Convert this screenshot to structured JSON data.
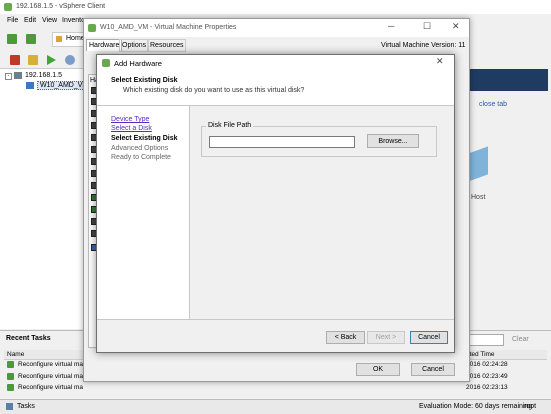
{
  "vsphere": {
    "title": "192.168.1.5 - vSphere Client",
    "menu": [
      "File",
      "Edit",
      "View",
      "Invento"
    ],
    "home_label": "Home",
    "tree": {
      "host": "192.168.1.5",
      "vm": "W10_AMD_VM"
    },
    "close_tab": "close tab",
    "host_label": "Host",
    "clear_label": "Clear",
    "recent_tasks_title": "Recent Tasks",
    "name_header": "Name",
    "completed_time_header": "eted Time",
    "tasks": [
      {
        "name": "Reconfigure virtual ma",
        "time": "2016 02:24:28"
      },
      {
        "name": "Reconfigure virtual ma",
        "time": "2016 02:23:49"
      },
      {
        "name": "Reconfigure virtual ma",
        "time": "2016 02:23:13"
      }
    ],
    "status_tasks": "Tasks",
    "status_eval": "Evaluation Mode: 60 days remaining",
    "status_user": "root"
  },
  "vmprops": {
    "title": "W10_AMD_VM - Virtual Machine Properties",
    "tabs": [
      "Hardware",
      "Options",
      "Resources"
    ],
    "version": "Virtual Machine Version: 11",
    "hw_col": "Ha",
    "ok_label": "OK",
    "cancel_label": "Cancel"
  },
  "wizard": {
    "title": "Add Hardware",
    "header_title": "Select Existing Disk",
    "header_subtitle": "Which existing disk do you want to use as this virtual disk?",
    "steps": [
      {
        "label": "Device Type",
        "state": "link"
      },
      {
        "label": "Select a Disk",
        "state": "link"
      },
      {
        "label": "Select Existing Disk",
        "state": "current"
      },
      {
        "label": "Advanced Options",
        "state": "future"
      },
      {
        "label": "Ready to Complete",
        "state": "future"
      }
    ],
    "group_label": "Disk File Path",
    "path_value": "",
    "browse_label": "Browse...",
    "back_label": "< Back",
    "next_label": "Next >",
    "cancel_label": "Cancel"
  }
}
